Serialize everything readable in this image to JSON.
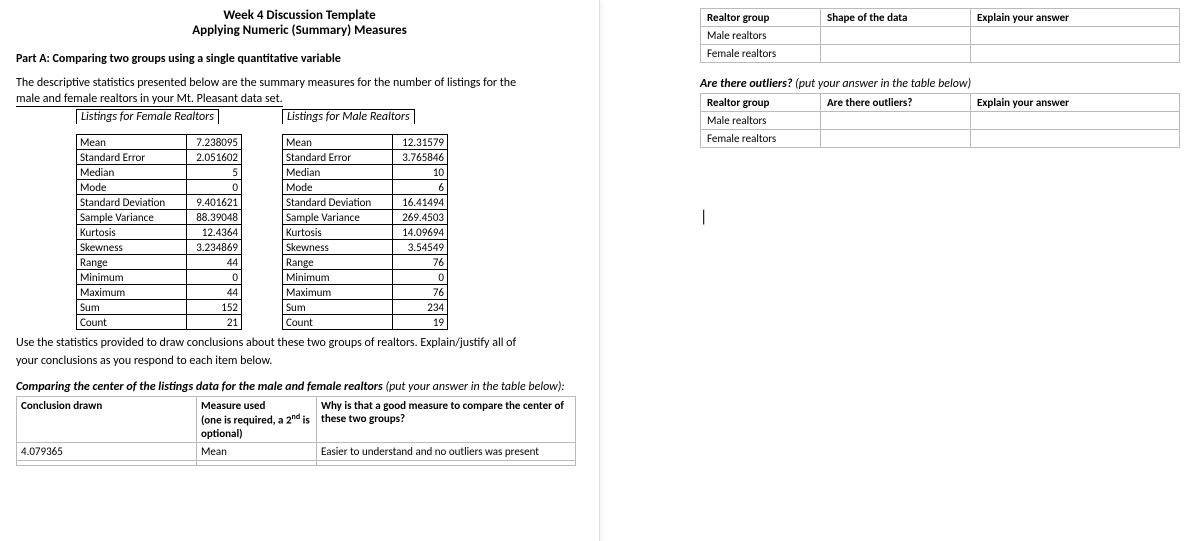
{
  "header": {
    "title": "Week 4 Discussion Template",
    "subtitle": "Applying Numeric (Summary) Measures"
  },
  "partA": {
    "heading": "Part A:  Comparing two groups using a single quantitative variable",
    "intro1": "The descriptive statistics presented below are the summary measures for the number of listings for the",
    "intro2": "male and female realtors in your Mt. Pleasant data set."
  },
  "femaleHeader": "Listings for Female Realtors",
  "maleHeader": "Listings for Male Realtors",
  "labels": {
    "mean": "Mean",
    "stderr": "Standard Error",
    "median": "Median",
    "mode": "Mode",
    "stddev": "Standard Deviation",
    "svar": "Sample Variance",
    "kurt": "Kurtosis",
    "skew": "Skewness",
    "range": "Range",
    "min": "Minimum",
    "max": "Maximum",
    "sum": "Sum",
    "count": "Count"
  },
  "female": {
    "mean": "7.238095",
    "stderr": "2.051602",
    "median": "5",
    "mode": "0",
    "stddev": "9.401621",
    "svar": "88.39048",
    "kurt": "12.4364",
    "skew": "3.234869",
    "range": "44",
    "min": "0",
    "max": "44",
    "sum": "152",
    "count": "21"
  },
  "male": {
    "mean": "12.31579",
    "stderr": "3.765846",
    "median": "10",
    "mode": "6",
    "stddev": "16.41494",
    "svar": "269.4503",
    "kurt": "14.09694",
    "skew": "3.54549",
    "range": "76",
    "min": "0",
    "max": "76",
    "sum": "234",
    "count": "19"
  },
  "follow1": "Use the statistics provided to draw conclusions about these two groups of realtors. Explain/justify all of",
  "follow2": "your conclusions as you respond to each item below.",
  "compareHeading": "Comparing the center of the listings data for the male and female realtors ",
  "compareParen": "(put your answer in the table below):",
  "compareTable": {
    "h1": "Conclusion drawn",
    "h2a": "Measure used",
    "h2b": "(one is required, a 2",
    "h2c": "nd",
    "h2d": " is optional)",
    "h3": "Why is that a good measure to compare the center of these two groups?",
    "r1c1": "4.079365",
    "r1c2": "Mean",
    "r1c3": "Easier to understand and no outliers was present"
  },
  "rightShape": {
    "h1": "Realtor group",
    "h2": "Shape of the data",
    "h3": "Explain your answer",
    "r1": "Male realtors",
    "r2": "Female realtors"
  },
  "outlierQ": {
    "bold": "Are there outliers? ",
    "paren": "(put your answer in the table below)"
  },
  "rightOutlier": {
    "h1": "Realtor group",
    "h2": "Are there outliers?",
    "h3": "Explain your answer",
    "r1": "Male realtors",
    "r2": "Female realtors"
  },
  "cursor": "|"
}
